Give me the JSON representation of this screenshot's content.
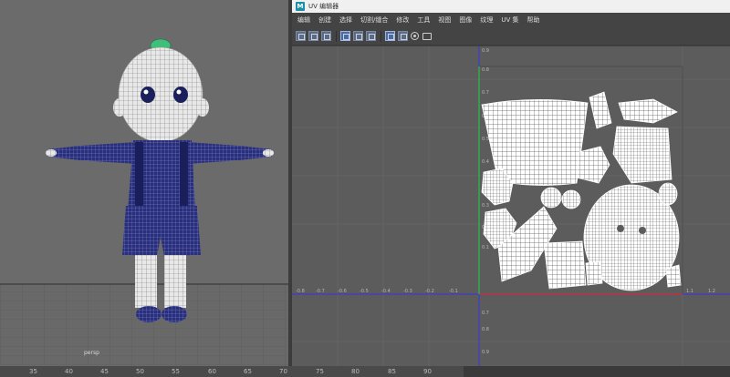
{
  "viewport": {
    "camera_label": "persp"
  },
  "uv_editor": {
    "title": "UV 编辑器",
    "logo_letter": "M",
    "menu": [
      "编辑",
      "创建",
      "选择",
      "切割/缝合",
      "修改",
      "工具",
      "视图",
      "图像",
      "纹理",
      "UV 集",
      "帮助"
    ],
    "toolbar_icons": [
      "uv-shell-icon",
      "uv-toggle-icon",
      "distribute-icon",
      "grid-icon",
      "checker-icon",
      "snap-icon",
      "isolate-icon",
      "shaded-icon",
      "target-icon",
      "snapshot-icon"
    ],
    "axis_labels_v": [
      "0.9",
      "0.8",
      "0.7",
      "0.6",
      "0.5",
      "0.4",
      "0.3",
      "0.2",
      "0.1"
    ],
    "axis_labels_v_neg": [
      "0.7",
      "0.8",
      "0.9"
    ],
    "axis_labels_u_neg": [
      "-0.8",
      "-0.7",
      "-0.6",
      "-0.5",
      "-0.4",
      "-0.3",
      "-0.2",
      "-0.1"
    ],
    "axis_labels_u_pos": [
      "1.1",
      "1.2"
    ],
    "colors": {
      "u_axis": "#3d3dd0",
      "v_axis": "#3d3dd0",
      "u_positive": "#d03030",
      "v_positive": "#30c040",
      "wire": "#ffffff"
    }
  },
  "timeline": {
    "ticks": [
      "35",
      "40",
      "45",
      "50",
      "55",
      "60",
      "65",
      "70",
      "75",
      "80",
      "85",
      "90"
    ]
  }
}
